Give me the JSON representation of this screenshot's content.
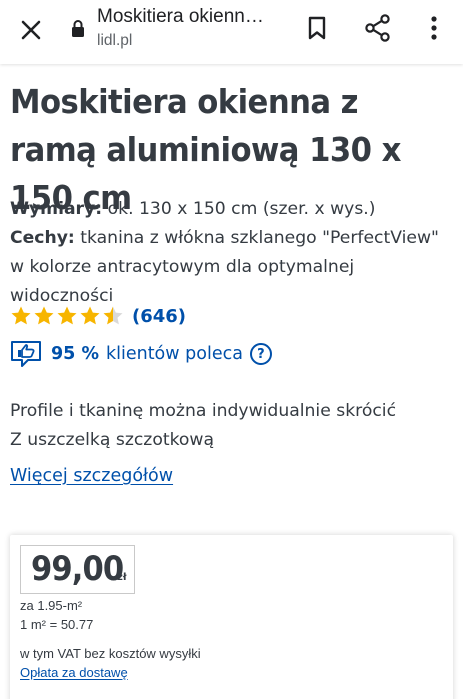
{
  "browser": {
    "page_title": "Moskitiera okienn…",
    "url": "lidl.pl",
    "icons": [
      "close-icon",
      "lock-icon",
      "bookmark-icon",
      "share-icon",
      "more-vert-icon"
    ]
  },
  "product": {
    "title": "Moskitiera okienna z ramą aluminiową 130 x 150 cm",
    "dimensions_label": "Wymiary:",
    "dimensions_value": "ok. 130 x 150 cm (szer. x wys.)",
    "features_label": "Cechy:",
    "features_value": "tkanina z włókna szklanego \"PerfectView\" w kolorze antracytowym dla optymalnej widoczności",
    "rating": {
      "stars": 4.5,
      "max_stars": 5,
      "count": "(646)",
      "star_color": "#f7b500"
    },
    "recommend": {
      "percent": "95 %",
      "text": "klientów poleca",
      "help": "?"
    },
    "bullets": [
      "Profile i tkaninę można indywidualnie skrócić",
      "Z uszczelką szczotkową"
    ],
    "more_link": "Więcej szczegółów"
  },
  "price": {
    "value": "99,00",
    "currency": "zł",
    "per_area": "za 1.95-m²",
    "unit_price": "1 m² = 50.77",
    "vat_note": "w tym VAT bez kosztów wysyłki",
    "shipping_link": "Opłata za dostawę"
  },
  "colors": {
    "link_blue": "#0050aa",
    "text_dark": "#353b42"
  }
}
